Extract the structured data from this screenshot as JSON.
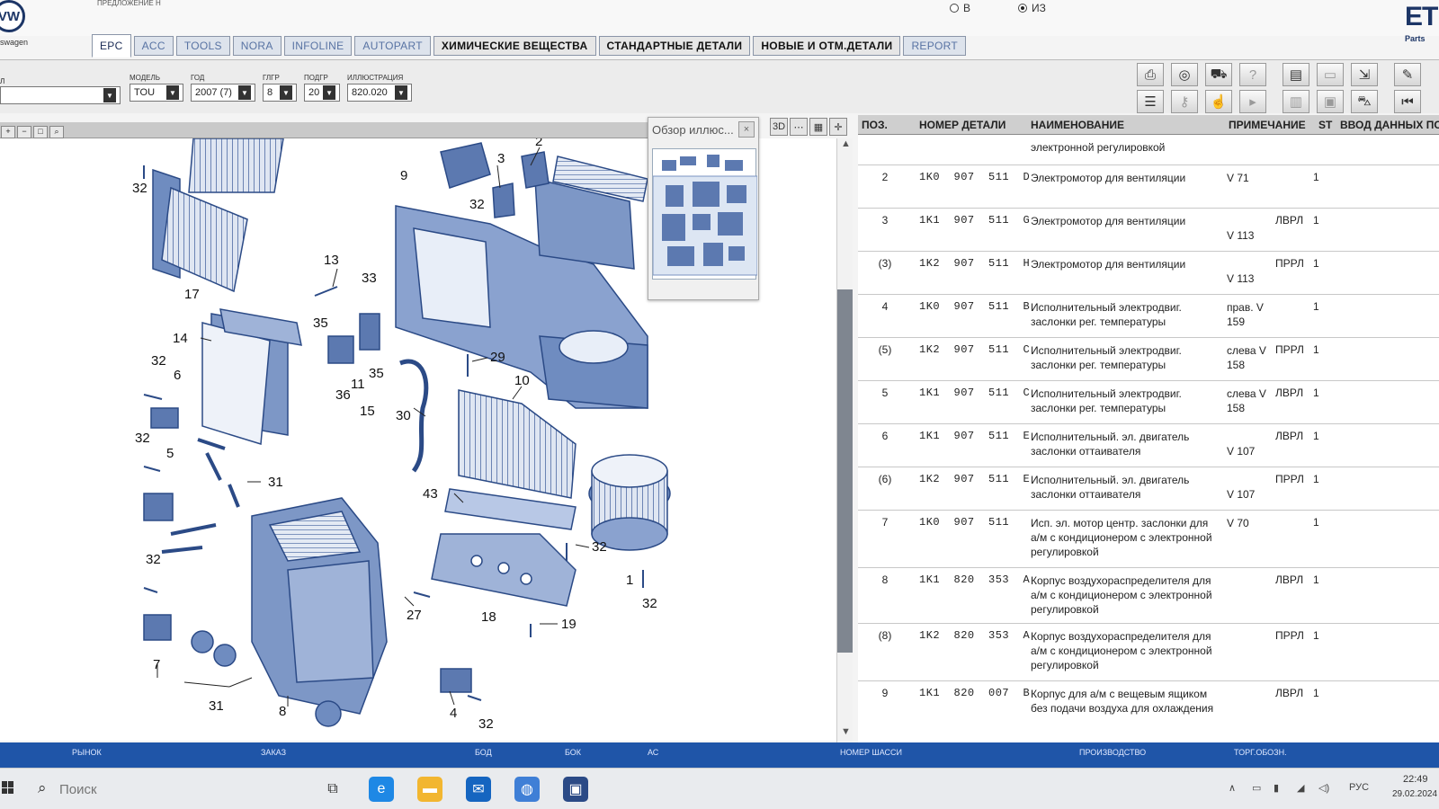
{
  "header": {
    "logo_letters": "VW",
    "brand_fragment": "swagen",
    "top_caption": "ПРЕДЛОЖЕНИЕ H",
    "radio_b": "В",
    "radio_iz": "ИЗ",
    "radio_selected": "ИЗ",
    "app_logo": "ET",
    "app_sub": "Parts"
  },
  "tabs": [
    "EPC",
    "ACC",
    "TOOLS",
    "NORA",
    "INFOLINE",
    "AUTOPART",
    "ХИМИЧЕСКИЕ ВЕЩЕСТВА",
    "СТАНДАРТНЫЕ ДЕТАЛИ",
    "НОВЫЕ И ОТМ.ДЕТАЛИ",
    "REPORT"
  ],
  "active_tab": "EPC",
  "selectors": {
    "market_label": "Л",
    "market_value": "",
    "model_label": "МОДЕЛЬ",
    "model_value": "TOU",
    "year_label": "ГОД",
    "year_value": "2007 (7)",
    "group_label": "ГЛГР",
    "group_value": "8",
    "subgroup_label": "ПОДГР",
    "subgroup_value": "20",
    "illustration_label": "ИЛЛЮСТРАЦИЯ",
    "illustration_value": "820.020"
  },
  "toolbar_icons": [
    "print-icon",
    "search-part-icon",
    "car-icon",
    "help-icon",
    "basket-icon",
    "document-icon",
    "export-icon",
    "pin-icon",
    "list-icon",
    "key-icon",
    "hand-icon",
    "next-icon",
    "columns-icon",
    "document-search-icon",
    "cart-icon",
    "first-page-icon"
  ],
  "overview": {
    "title": "Обзор иллюс...",
    "close": "×"
  },
  "view_buttons": [
    "3D",
    "⋯",
    "▦",
    "✛"
  ],
  "diagram_labels": [
    "2",
    "3",
    "9",
    "32",
    "32",
    "17",
    "13",
    "33",
    "14",
    "35",
    "29",
    "32",
    "6",
    "11",
    "35",
    "36",
    "15",
    "30",
    "10",
    "32",
    "5",
    "31",
    "43",
    "32",
    "32",
    "18",
    "1",
    "32",
    "27",
    "19",
    "7",
    "31",
    "8",
    "4",
    "32"
  ],
  "table": {
    "headers": {
      "pos": "ПОЗ.",
      "part_number": "НОМЕР ДЕТАЛИ",
      "name": "НАИМЕНОВАНИЕ",
      "note": "ПРИМЕЧАНИЕ",
      "qty": "ST",
      "input": "ВВОД ДАННЫХ ПО"
    },
    "rows": [
      {
        "pos": "",
        "part": "",
        "name": "электронной регулировкой",
        "note": "",
        "mod": "",
        "qty": ""
      },
      {
        "pos": "2",
        "part": "1K0  907  511  D",
        "name": "Электромотор для вентиляции",
        "note": "V 71",
        "mod": "",
        "qty": "1"
      },
      {
        "pos": "3",
        "part": "1K1  907  511  G",
        "name": "Электромотор для вентиляции",
        "note": "V 113",
        "mod": "ЛВРЛ",
        "qty": "1"
      },
      {
        "pos": "(3)",
        "part": "1K2  907  511  H",
        "name": "Электромотор для вентиляции",
        "note": "V 113",
        "mod": "ПРРЛ",
        "qty": "1"
      },
      {
        "pos": "4",
        "part": "1K0  907  511  B",
        "name": "Исполнительный электродвиг. заслонки рег. температуры",
        "note": "прав. V 159",
        "mod": "",
        "qty": "1"
      },
      {
        "pos": "(5)",
        "part": "1K2  907  511  C",
        "name": "Исполнительный электродвиг. заслонки рег. температуры",
        "note": "слева V 158",
        "mod": "ПРРЛ",
        "qty": "1"
      },
      {
        "pos": "5",
        "part": "1K1  907  511  C",
        "name": "Исполнительный электродвиг. заслонки рег. температуры",
        "note": "слева V 158",
        "mod": "ЛВРЛ",
        "qty": "1"
      },
      {
        "pos": "6",
        "part": "1K1  907  511  E",
        "name": "Исполнительный. эл. двигатель заслонки оттаивателя",
        "note": "V 107",
        "mod": "ЛВРЛ",
        "qty": "1"
      },
      {
        "pos": "(6)",
        "part": "1K2  907  511  E",
        "name": "Исполнительный. эл. двигатель заслонки оттаивателя",
        "note": "V 107",
        "mod": "ПРРЛ",
        "qty": "1"
      },
      {
        "pos": "7",
        "part": "1K0  907  511",
        "name": "Исп. эл. мотор центр. заслонки для а/м с кондиционером с электронной регулировкой",
        "note": "V 70",
        "mod": "",
        "qty": "1"
      },
      {
        "pos": "8",
        "part": "1K1  820  353  A",
        "name": "Корпус воздухораспределителя для а/м с кондиционером с электронной регулировкой",
        "note": "",
        "mod": "ЛВРЛ",
        "qty": "1"
      },
      {
        "pos": "(8)",
        "part": "1K2  820  353  A",
        "name": "Корпус воздухораспределителя для а/м с кондиционером с электронной регулировкой",
        "note": "",
        "mod": "ПРРЛ",
        "qty": "1"
      },
      {
        "pos": "9",
        "part": "1K1  820  007  B",
        "name": "Корпус для а/м с вещевым ящиком без подачи воздуха для охлаждения",
        "note": "",
        "mod": "ЛВРЛ",
        "qty": "1"
      }
    ]
  },
  "statusbar": [
    "РЫНОК",
    "ЗАКАЗ",
    "БОД",
    "БОК",
    "АС",
    "НОМЕР ШАССИ",
    "ПРОИЗВОДСТВО",
    "ТОРГ.ОБОЗН."
  ],
  "taskbar": {
    "search_placeholder": "Поиск",
    "language": "РУС",
    "time": "22:49",
    "date": "29.02.2024"
  },
  "colors": {
    "statusbar": "#1f55a8",
    "tab_text": "#5873a3",
    "scroll_thumb": "#7f8690",
    "diagram_part": "#3a5a9a"
  }
}
